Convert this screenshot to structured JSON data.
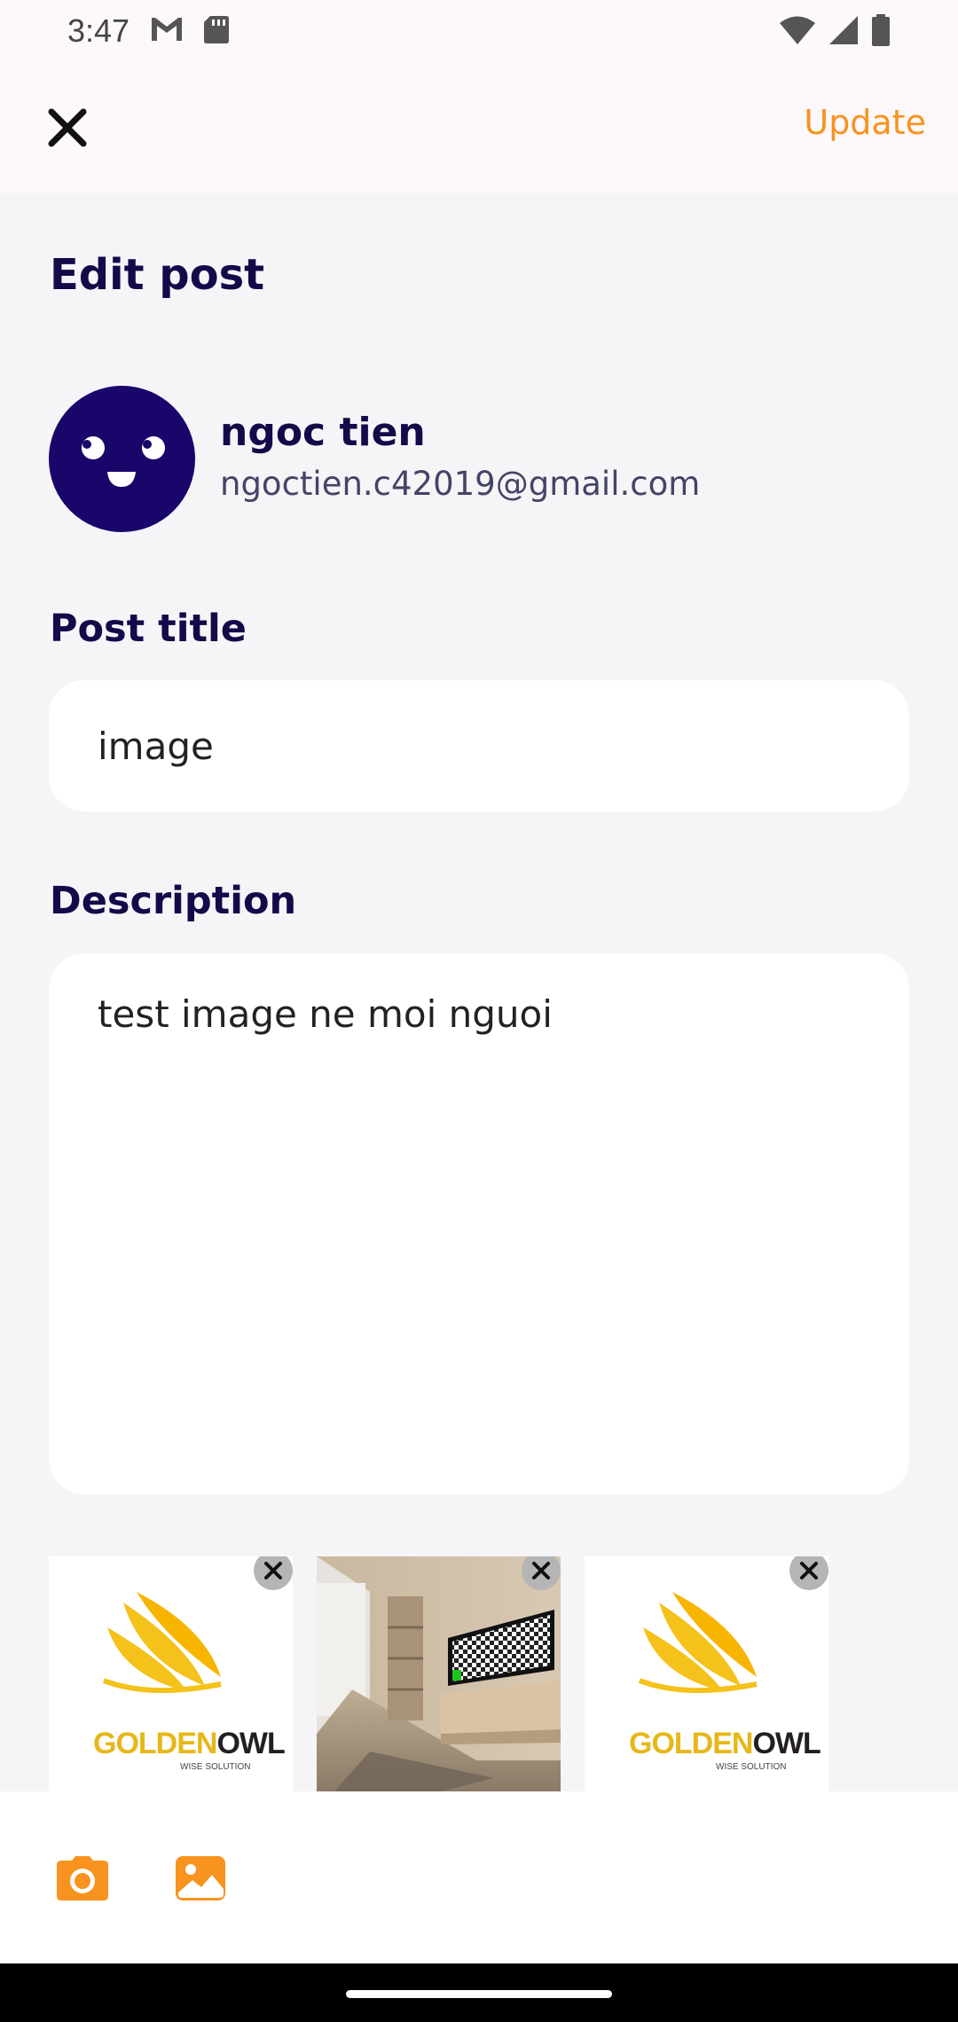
{
  "status_bar": {
    "time": "3:47",
    "left_icons": [
      "gmail-icon",
      "sd-card-icon"
    ],
    "right_icons": [
      "wifi-icon",
      "signal-icon",
      "battery-icon"
    ]
  },
  "app_bar": {
    "close_icon": "close-icon",
    "update_label": "Update",
    "accent_color": "#f7931e"
  },
  "page": {
    "title": "Edit post"
  },
  "user": {
    "name": "ngoc tien",
    "email": "ngoctien.c42019@gmail.com",
    "avatar_color": "#1a056b"
  },
  "form": {
    "title_label": "Post title",
    "title_value": "image",
    "description_label": "Description",
    "description_value": "test image ne moi nguoi"
  },
  "attachments": [
    {
      "kind": "logo",
      "logo_text_gold": "GOLDEN",
      "logo_text_dark": "OWL",
      "logo_sub": "WISE SOLUTION"
    },
    {
      "kind": "photo",
      "subject": "living room with tv"
    },
    {
      "kind": "logo",
      "logo_text_gold": "GOLDEN",
      "logo_text_dark": "OWL",
      "logo_sub": "WISE SOLUTION"
    }
  ],
  "toolbar": {
    "camera_icon": "camera-icon",
    "gallery_icon": "image-gallery-icon"
  }
}
